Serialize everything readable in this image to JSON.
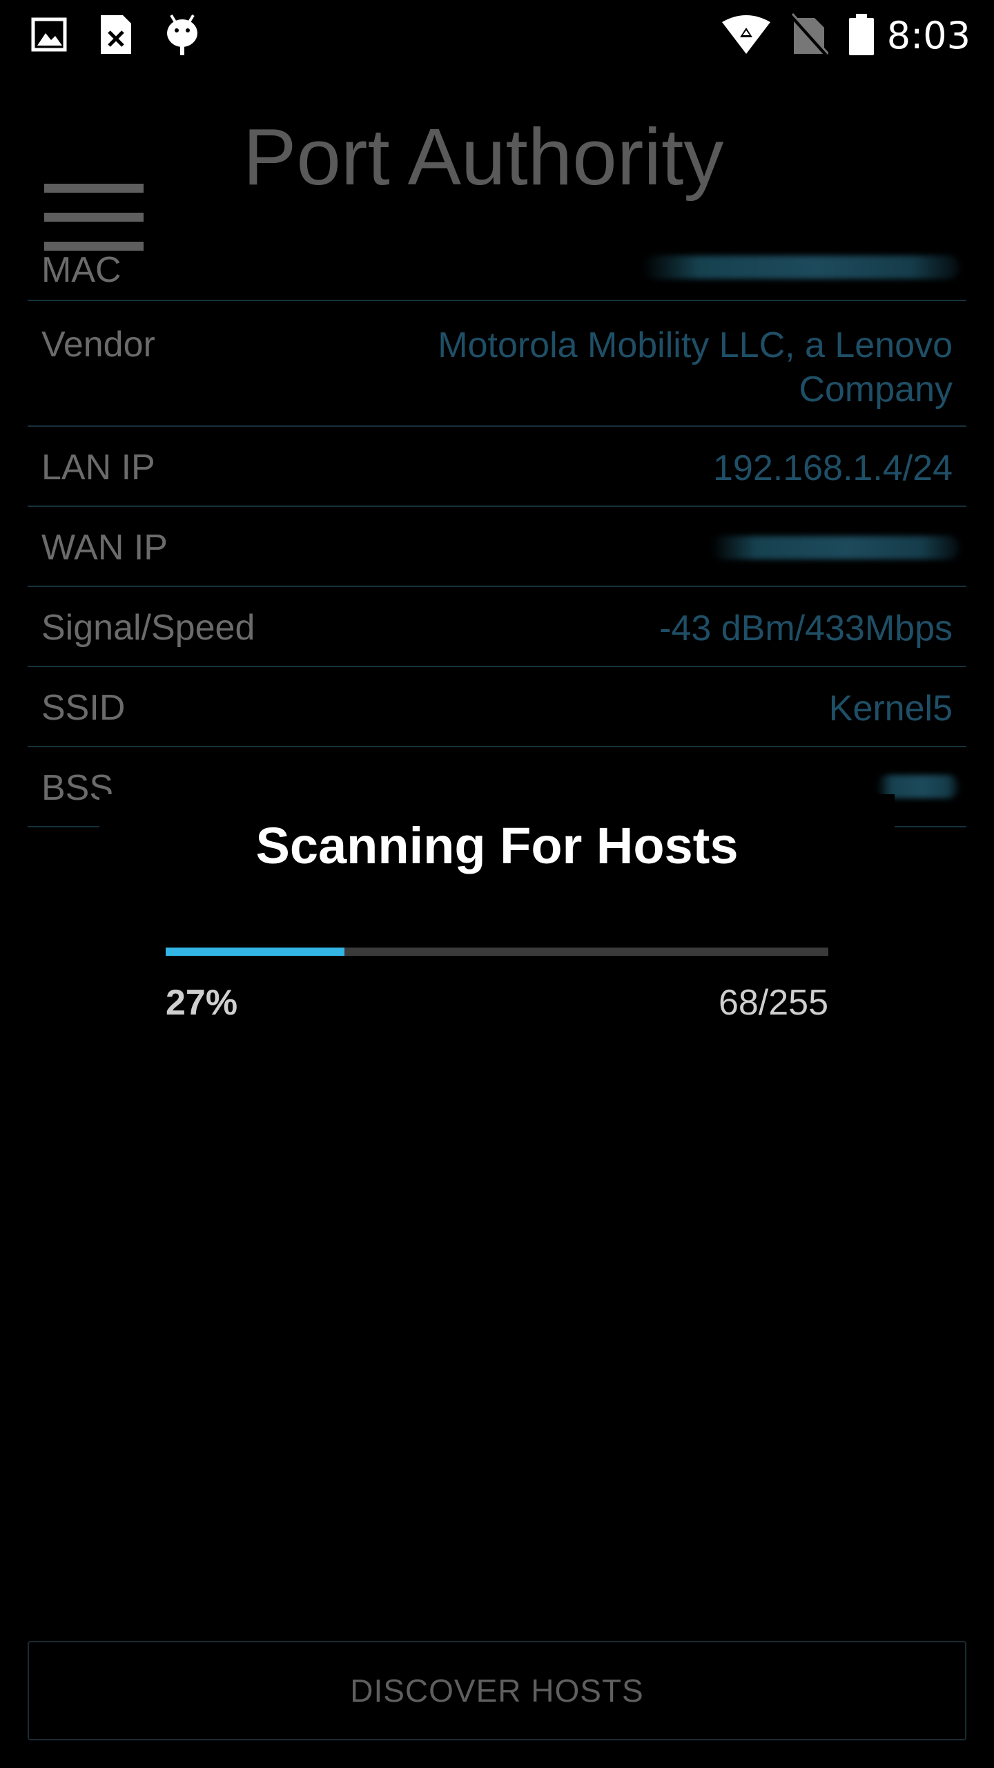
{
  "status_bar": {
    "time": "8:03",
    "left_icons": [
      "gallery-icon",
      "sim-card-error-icon",
      "android-debug-icon"
    ],
    "right_icons": [
      "wifi-icon",
      "no-sim-icon",
      "battery-icon"
    ]
  },
  "app_bar": {
    "title": "Port Authority",
    "menu_icon": "hamburger-menu-icon"
  },
  "info": {
    "mac": {
      "label": "MAC",
      "value_redacted": true
    },
    "vendor": {
      "label": "Vendor",
      "value": "Motorola Mobility LLC, a Lenovo Company"
    },
    "lan_ip": {
      "label": "LAN IP",
      "value": "192.168.1.4/24"
    },
    "wan_ip": {
      "label": "WAN IP",
      "value_redacted": true
    },
    "signal_speed": {
      "label": "Signal/Speed",
      "value": "-43 dBm/433Mbps"
    },
    "ssid": {
      "label": "SSID",
      "value": "Kernel5"
    },
    "bssid": {
      "label": "BSS",
      "value_redacted": true
    }
  },
  "dialog": {
    "title": "Scanning For Hosts",
    "progress_fraction": 0.27,
    "percent_text": "27%",
    "count_text": "68/255"
  },
  "actions": {
    "discover_hosts_label": "DISCOVER HOSTS"
  },
  "colors": {
    "accent": "#33b5e5",
    "value_text": "#1f4f66",
    "divider": "#17313d",
    "background": "#000000"
  }
}
